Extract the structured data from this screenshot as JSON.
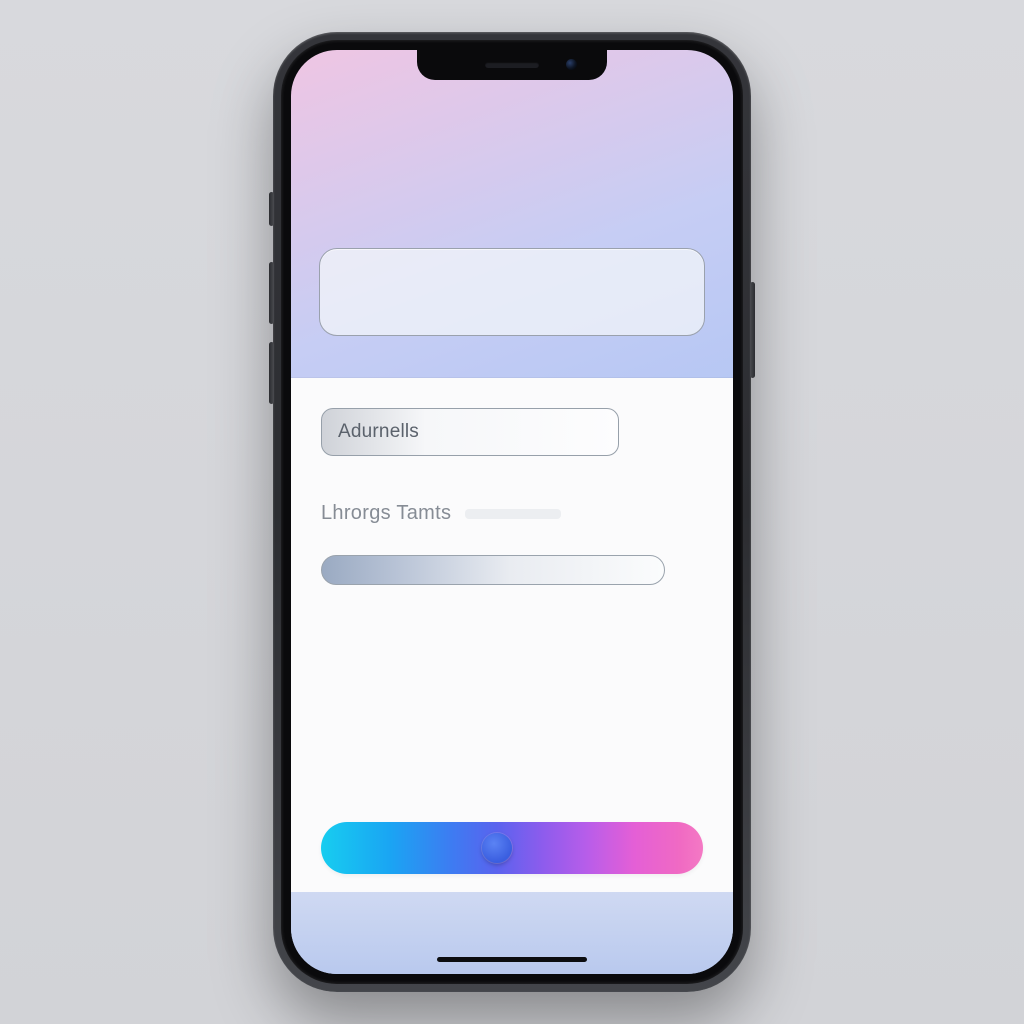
{
  "form": {
    "field1_label": "Adurnells",
    "section_label": "Lhrorgs Tamts"
  },
  "colors": {
    "hue_gradient_stops": [
      "#17cdf0",
      "#1aa5f3",
      "#3d7cf2",
      "#5a63ee",
      "#8d5ced",
      "#b95de9",
      "#e45fd6",
      "#f06ac3",
      "#f479c4"
    ]
  }
}
